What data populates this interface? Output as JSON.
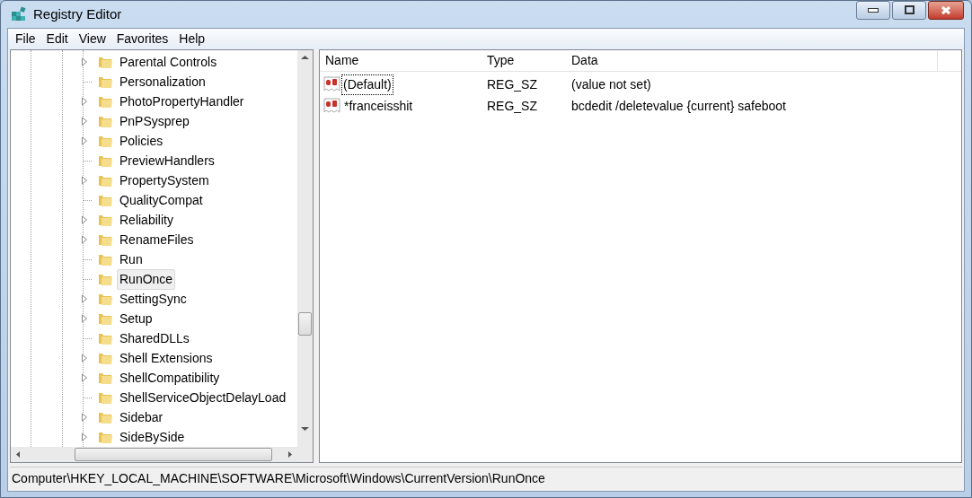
{
  "window": {
    "title": "Registry Editor"
  },
  "menu": [
    "File",
    "Edit",
    "View",
    "Favorites",
    "Help"
  ],
  "tree": {
    "items": [
      {
        "label": "Parental Controls",
        "expandable": true,
        "selected": false
      },
      {
        "label": "Personalization",
        "expandable": false,
        "selected": false
      },
      {
        "label": "PhotoPropertyHandler",
        "expandable": true,
        "selected": false
      },
      {
        "label": "PnPSysprep",
        "expandable": true,
        "selected": false
      },
      {
        "label": "Policies",
        "expandable": true,
        "selected": false
      },
      {
        "label": "PreviewHandlers",
        "expandable": false,
        "selected": false
      },
      {
        "label": "PropertySystem",
        "expandable": true,
        "selected": false
      },
      {
        "label": "QualityCompat",
        "expandable": false,
        "selected": false
      },
      {
        "label": "Reliability",
        "expandable": true,
        "selected": false
      },
      {
        "label": "RenameFiles",
        "expandable": true,
        "selected": false
      },
      {
        "label": "Run",
        "expandable": false,
        "selected": false
      },
      {
        "label": "RunOnce",
        "expandable": false,
        "selected": true
      },
      {
        "label": "SettingSync",
        "expandable": true,
        "selected": false
      },
      {
        "label": "Setup",
        "expandable": true,
        "selected": false
      },
      {
        "label": "SharedDLLs",
        "expandable": false,
        "selected": false
      },
      {
        "label": "Shell Extensions",
        "expandable": true,
        "selected": false
      },
      {
        "label": "ShellCompatibility",
        "expandable": true,
        "selected": false
      },
      {
        "label": "ShellServiceObjectDelayLoad",
        "expandable": false,
        "selected": false
      },
      {
        "label": "Sidebar",
        "expandable": true,
        "selected": false
      },
      {
        "label": "SideBySide",
        "expandable": true,
        "selected": false
      }
    ]
  },
  "values": {
    "columns": [
      "Name",
      "Type",
      "Data"
    ],
    "rows": [
      {
        "name": "(Default)",
        "type": "REG_SZ",
        "data": "(value not set)",
        "focused": true
      },
      {
        "name": "*franceisshit",
        "type": "REG_SZ",
        "data": "bcdedit /deletevalue {current} safeboot",
        "focused": false
      }
    ]
  },
  "status_bar": "Computer\\HKEY_LOCAL_MACHINE\\SOFTWARE\\Microsoft\\Windows\\CurrentVersion\\RunOnce"
}
